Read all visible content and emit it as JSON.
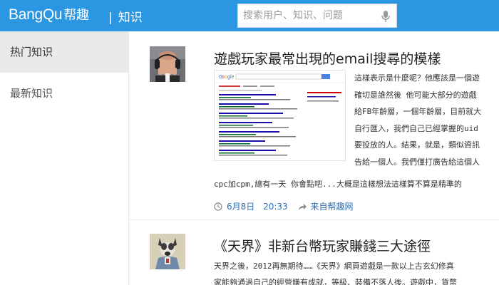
{
  "header": {
    "logo": "BangQu",
    "logo_cn": "帮趣",
    "separator": "|",
    "section": "知识",
    "search_placeholder": "搜索用户、知识、问题",
    "bg_color": "#2b97e3"
  },
  "sidebar": {
    "items": [
      {
        "label": "热门知识",
        "active": true
      },
      {
        "label": "最新知识",
        "active": false
      }
    ]
  },
  "posts": [
    {
      "title": "遊戲玩家最常出現的email搜尋的模樣",
      "excerpt_lines": [
        "這樣表示是什麼呢？他應該是一個遊",
        "確切是誰然後 他可能大部分的遊戲",
        "給FB年齡層，一個年齡層，目前就大",
        "自行匯入，我們自己已經掌握的uid",
        "要投放的人。結果，就是，類似資訊",
        "告給一個人。我們僅打廣告給這個人"
      ],
      "excerpt_tail": "cpc加cpm,總有一天 你會點吧...大概是這樣想法這樣算不算是精準的",
      "date": "6月8日",
      "time": "20:33",
      "source": "来自帮趣网"
    },
    {
      "title": "《天界》非新台幣玩家賺錢三大途徑",
      "excerpt_lines": [
        "天界之後，2012再無期待……《天界》網頁遊戲是一款以上古玄幻修真",
        "家能夠通過自己的經營賺有成就，等級、裝備不落人後。遊戲中，貨幣"
      ]
    }
  ]
}
